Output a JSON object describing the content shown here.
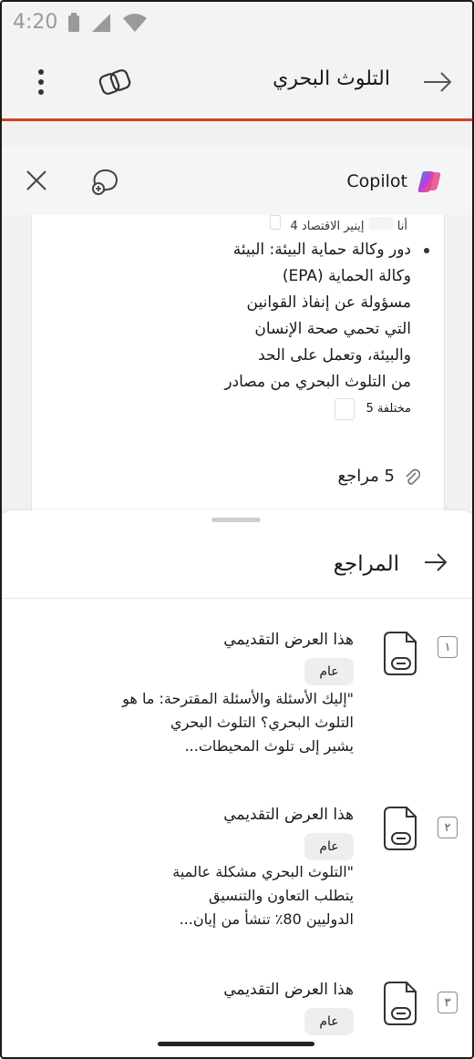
{
  "status": {
    "time": "4:20"
  },
  "header": {
    "title": "التلوث البحري"
  },
  "copilot": {
    "brand_label": "Copilot",
    "partial_line": "إينير الاقتصاد 4",
    "partial_prefix": "أنا",
    "bullet_lines": [
      "دور وكالة حماية البيئة: البيئة",
      "وكالة الحماية (EPA)",
      "مسؤولة عن إنفاذ القوانين",
      "التي تحمي صحة الإنسان",
      "والبيئة، وتعمل على الحد",
      "من التلوث البحري من مصادر"
    ],
    "bullet_last": "مختلفة 5",
    "refs_count_label": "5 مراجع"
  },
  "sheet": {
    "title": "المراجع",
    "refs": [
      {
        "num": "١",
        "title": "هذا العرض التقديمي",
        "badge": "عام",
        "lines": [
          "\"إليك الأسئلة والأسئلة المقترحة: ما هو",
          "التلوث البحري؟ التلوث البحري",
          "يشير إلى تلوث المحيطات..."
        ]
      },
      {
        "num": "٢",
        "title": "هذا العرض التقديمي",
        "badge": "عام",
        "lines": [
          "\"التلوث البحري مشكلة عالمية",
          "يتطلب التعاون والتنسيق",
          "الدوليين 80٪ تنشأ من إيان..."
        ]
      },
      {
        "num": "٣",
        "title": "هذا العرض التقديمي",
        "badge": "عام",
        "lines": []
      }
    ]
  }
}
